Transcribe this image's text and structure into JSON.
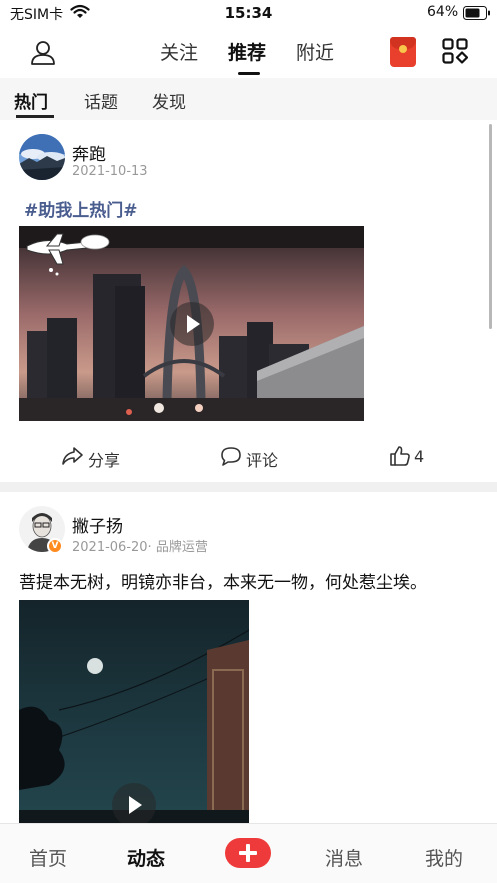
{
  "status_bar": {
    "carrier": "无SIM卡",
    "time": "15:34",
    "battery": "64%"
  },
  "top_nav": {
    "tabs": [
      {
        "label": "关注",
        "active": false
      },
      {
        "label": "推荐",
        "active": true
      },
      {
        "label": "附近",
        "active": false
      }
    ],
    "icons": [
      "user-icon",
      "red-packet-icon",
      "apps-grid-icon"
    ]
  },
  "sub_tabs": [
    {
      "label": "热门",
      "active": true
    },
    {
      "label": "话题",
      "active": false
    },
    {
      "label": "发现",
      "active": false
    }
  ],
  "posts": [
    {
      "username": "奔跑",
      "meta": "2021-10-13",
      "hashtag": "#助我上热门#",
      "actions": {
        "share": "分享",
        "comment": "评论",
        "likes": "4"
      }
    },
    {
      "username": "撇子扬",
      "meta": "2021-06-20· 品牌运营",
      "verified_badge": "V",
      "text": "菩提本无树，明镜亦非台，本来无一物，何处惹尘埃。"
    }
  ],
  "tab_bar": {
    "items": [
      {
        "label": "首页",
        "active": false
      },
      {
        "label": "动态",
        "active": true
      },
      {
        "label": "消息",
        "active": false
      },
      {
        "label": "我的",
        "active": false
      }
    ],
    "add_color": "#ee3a3a"
  }
}
